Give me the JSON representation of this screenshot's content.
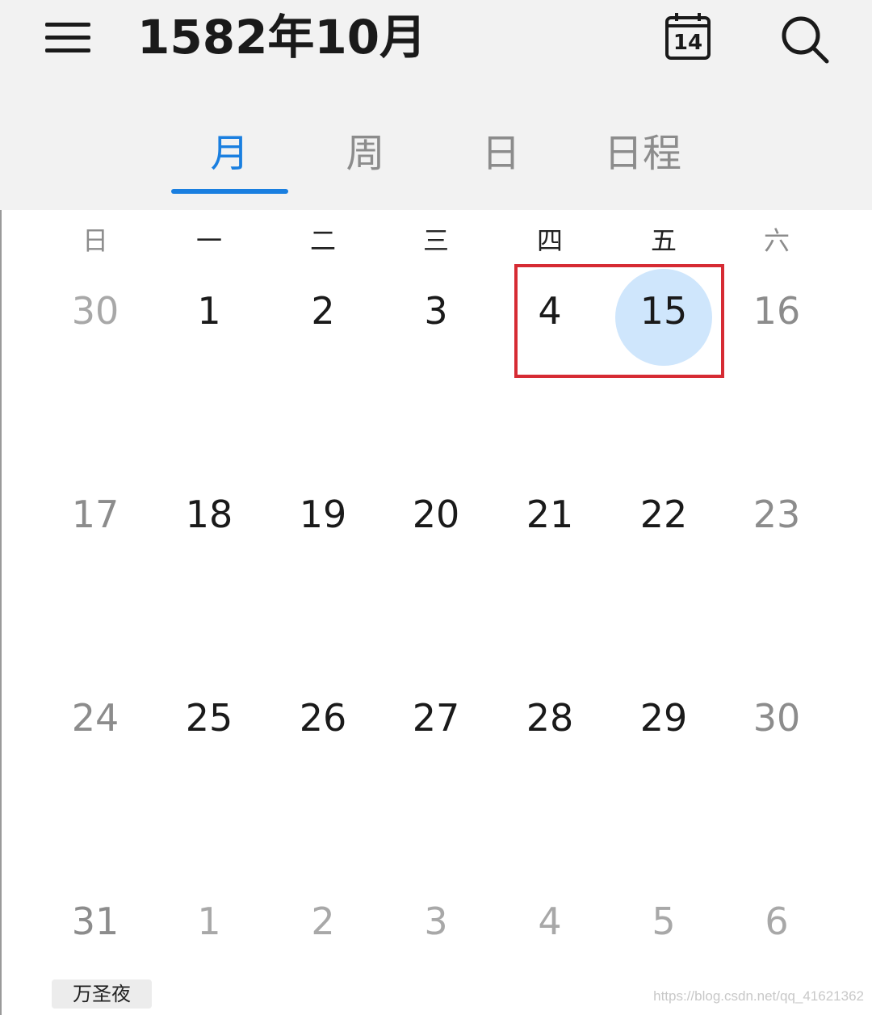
{
  "header": {
    "title": "1582年10月",
    "today_icon_number": "14"
  },
  "tabs": [
    {
      "label": "月",
      "active": true
    },
    {
      "label": "周",
      "active": false
    },
    {
      "label": "日",
      "active": false
    },
    {
      "label": "日程",
      "active": false
    }
  ],
  "weekdays": [
    "日",
    "一",
    "二",
    "三",
    "四",
    "五",
    "六"
  ],
  "weeks": [
    [
      "30",
      "1",
      "2",
      "3",
      "4",
      "15",
      "16"
    ],
    [
      "17",
      "18",
      "19",
      "20",
      "21",
      "22",
      "23"
    ],
    [
      "24",
      "25",
      "26",
      "27",
      "28",
      "29",
      "30"
    ],
    [
      "31",
      "1",
      "2",
      "3",
      "4",
      "5",
      "6"
    ]
  ],
  "selected_day": "15",
  "event": {
    "label": "万圣夜"
  },
  "watermark": "https://blog.csdn.net/qq_41621362",
  "colors": {
    "accent": "#1a7fe0",
    "selected_fill": "#cfe6fc",
    "highlight_box": "#d62b33",
    "header_bg": "#f2f2f2"
  }
}
